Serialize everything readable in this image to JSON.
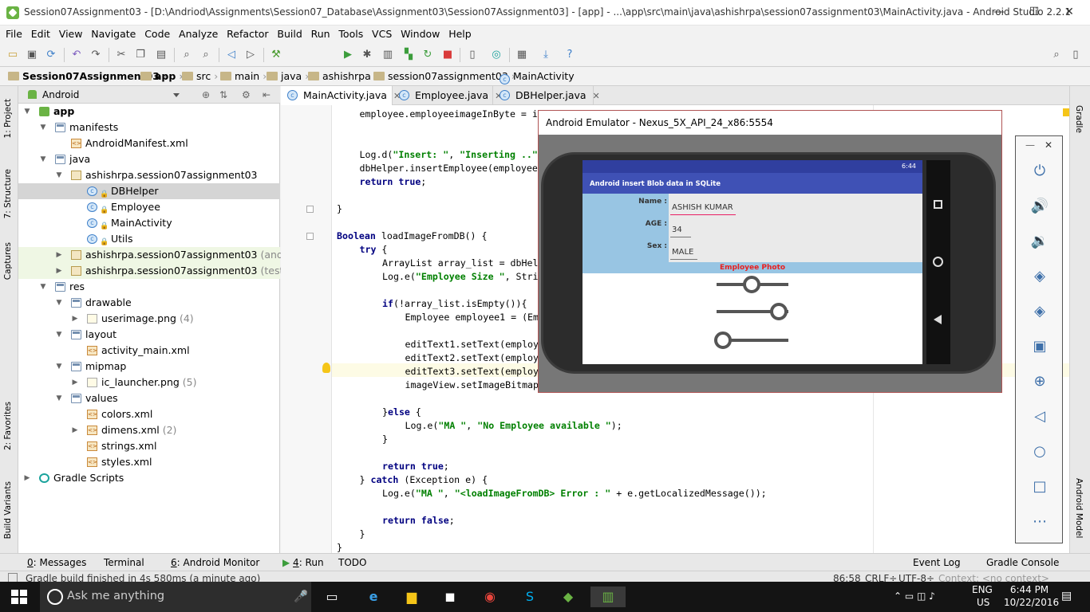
{
  "window": {
    "title": "Session07Assignment03 - [D:\\Andriod\\Assignments\\Session07_Database\\Assignment03\\Session07Assignment03] - [app] - ...\\app\\src\\main\\java\\ashishrpa\\session07assignment03\\MainActivity.java - Android Studio 2.2.1"
  },
  "menu": [
    "File",
    "Edit",
    "View",
    "Navigate",
    "Code",
    "Analyze",
    "Refactor",
    "Build",
    "Run",
    "Tools",
    "VCS",
    "Window",
    "Help"
  ],
  "toolbar": {
    "run_config": "app"
  },
  "breadcrumb": [
    "Session07Assignment03",
    "app",
    "src",
    "main",
    "java",
    "ashishrpa",
    "session07assignment03",
    "MainActivity"
  ],
  "left_tabs": [
    "1: Project",
    "7: Structure",
    "Captures",
    "2: Favorites",
    "Build Variants"
  ],
  "right_tabs": [
    "Gradle",
    "Android Model"
  ],
  "project": {
    "view_selector": "Android",
    "tree": [
      {
        "label": "app",
        "icon": "app-folder-icon",
        "depth": 0,
        "arrow": "▼",
        "bold": true
      },
      {
        "label": "manifests",
        "icon": "folder-icon",
        "depth": 1,
        "arrow": "▼"
      },
      {
        "label": "AndroidManifest.xml",
        "icon": "xml-file-icon",
        "depth": 2,
        "arrow": ""
      },
      {
        "label": "java",
        "icon": "folder-icon",
        "depth": 1,
        "arrow": "▼"
      },
      {
        "label": "ashishrpa.session07assignment03",
        "icon": "package-icon",
        "depth": 2,
        "arrow": "▼"
      },
      {
        "label": "DBHelper",
        "icon": "class-icon",
        "depth": 3,
        "arrow": "",
        "selected": true
      },
      {
        "label": "Employee",
        "icon": "class-icon",
        "depth": 3,
        "arrow": ""
      },
      {
        "label": "MainActivity",
        "icon": "class-icon",
        "depth": 3,
        "arrow": ""
      },
      {
        "label": "Utils",
        "icon": "class-icon",
        "depth": 3,
        "arrow": ""
      },
      {
        "label": "ashishrpa.session07assignment03",
        "suffix": "(androidTest)",
        "icon": "package-icon",
        "depth": 2,
        "arrow": "▶",
        "test": true
      },
      {
        "label": "ashishrpa.session07assignment03",
        "suffix": "(test)",
        "icon": "package-icon",
        "depth": 2,
        "arrow": "▶",
        "test": true
      },
      {
        "label": "res",
        "icon": "folder-icon",
        "depth": 1,
        "arrow": "▼"
      },
      {
        "label": "drawable",
        "icon": "folder-icon",
        "depth": 2,
        "arrow": "▼"
      },
      {
        "label": "userimage.png",
        "suffix": "(4)",
        "icon": "image-folder-icon",
        "depth": 3,
        "arrow": "▶"
      },
      {
        "label": "layout",
        "icon": "folder-icon",
        "depth": 2,
        "arrow": "▼"
      },
      {
        "label": "activity_main.xml",
        "icon": "xml-file-icon",
        "depth": 3,
        "arrow": ""
      },
      {
        "label": "mipmap",
        "icon": "folder-icon",
        "depth": 2,
        "arrow": "▼"
      },
      {
        "label": "ic_launcher.png",
        "suffix": "(5)",
        "icon": "image-folder-icon",
        "depth": 3,
        "arrow": "▶"
      },
      {
        "label": "values",
        "icon": "folder-icon",
        "depth": 2,
        "arrow": "▼"
      },
      {
        "label": "colors.xml",
        "icon": "xml-file-icon",
        "depth": 3,
        "arrow": ""
      },
      {
        "label": "dimens.xml",
        "suffix": "(2)",
        "icon": "xml-file-icon",
        "depth": 3,
        "arrow": "▶"
      },
      {
        "label": "strings.xml",
        "icon": "xml-file-icon",
        "depth": 3,
        "arrow": ""
      },
      {
        "label": "styles.xml",
        "icon": "xml-file-icon",
        "depth": 3,
        "arrow": ""
      },
      {
        "label": "Gradle Scripts",
        "icon": "gradle-icon",
        "depth": 0,
        "arrow": "▶"
      }
    ]
  },
  "editor_tabs": [
    {
      "label": "MainActivity.java",
      "active": true
    },
    {
      "label": "Employee.java",
      "active": false
    },
    {
      "label": "DBHelper.java",
      "active": false
    }
  ],
  "code": [
    {
      "indent": 2,
      "text": "employee.employeeimageInByte = i"
    },
    {
      "indent": 0,
      "text": ""
    },
    {
      "indent": 0,
      "text": ""
    },
    {
      "indent": 2,
      "text": "Log.d(\"Insert: \", \"Inserting ..\""
    },
    {
      "indent": 2,
      "text": "dbHelper.insertEmployee(employee"
    },
    {
      "indent": 2,
      "text": "return true;"
    },
    {
      "indent": 0,
      "text": ""
    },
    {
      "indent": 1,
      "text": "}"
    },
    {
      "indent": 0,
      "text": ""
    },
    {
      "indent": 1,
      "text": "Boolean loadImageFromDB() {"
    },
    {
      "indent": 2,
      "text": "try {"
    },
    {
      "indent": 3,
      "text": "ArrayList array_list = dbHel"
    },
    {
      "indent": 3,
      "text": "Log.e(\"Employee Size \", Stri"
    },
    {
      "indent": 0,
      "text": ""
    },
    {
      "indent": 3,
      "text": "if(!array_list.isEmpty()){"
    },
    {
      "indent": 4,
      "text": "Employee employee1 = (Em"
    },
    {
      "indent": 0,
      "text": ""
    },
    {
      "indent": 4,
      "text": "editText1.setText(employ"
    },
    {
      "indent": 4,
      "text": "editText2.setText(employ"
    },
    {
      "indent": 4,
      "text": "editText3.setText(employ"
    },
    {
      "indent": 4,
      "text": "imageView.setImageBitmap"
    },
    {
      "indent": 0,
      "text": ""
    },
    {
      "indent": 3,
      "text": "}else {"
    },
    {
      "indent": 4,
      "text": "Log.e(\"MA \", \"No Employee available \");"
    },
    {
      "indent": 3,
      "text": "}"
    },
    {
      "indent": 0,
      "text": ""
    },
    {
      "indent": 3,
      "text": "return true;"
    },
    {
      "indent": 2,
      "text": "} catch (Exception e) {"
    },
    {
      "indent": 3,
      "text": "Log.e(\"MA \", \"<loadImageFromDB> Error : \" + e.getLocalizedMessage());"
    },
    {
      "indent": 0,
      "text": ""
    },
    {
      "indent": 3,
      "text": "return false;"
    },
    {
      "indent": 2,
      "text": "}"
    },
    {
      "indent": 1,
      "text": "}"
    }
  ],
  "emulator": {
    "title": "Android Emulator - Nexus_5X_API_24_x86:5554",
    "status_time": "6:44",
    "app_title": "Android insert Blob data in SQLite",
    "form": [
      {
        "label": "Name :",
        "value": "ASHISH KUMAR"
      },
      {
        "label": "AGE :",
        "value": "34"
      },
      {
        "label": "Sex :",
        "value": "MALE"
      }
    ],
    "photo_label": "Employee Photo",
    "controls": [
      "power-icon",
      "volume-up-icon",
      "volume-down-icon",
      "rotate-left-icon",
      "rotate-right-icon",
      "camera-icon",
      "zoom-icon",
      "back-icon",
      "home-icon",
      "overview-icon",
      "more-icon"
    ]
  },
  "bottom_tabs": [
    {
      "key": "0",
      "label": ": Messages"
    },
    {
      "key": "",
      "label": "Terminal"
    },
    {
      "key": "6",
      "label": ": Android Monitor"
    },
    {
      "key": "4",
      "label": ": Run"
    },
    {
      "key": "",
      "label": "TODO"
    },
    {
      "key": "",
      "label": "Event Log"
    },
    {
      "key": "",
      "label": "Gradle Console"
    }
  ],
  "status": {
    "message": "Gradle build finished in 4s 580ms (a minute ago)",
    "position": "86:58",
    "line_sep": "CRLF÷",
    "encoding": "UTF-8÷",
    "context": "Context: <no context>"
  },
  "taskbar": {
    "search_placeholder": "Ask me anything",
    "lang": "ENG",
    "region": "US",
    "time": "6:44 PM",
    "date": "10/22/2016"
  },
  "colors": {
    "accent": "#3f51b5",
    "status_bar": "#303f9f",
    "form_bg": "#98c5e3",
    "photo_label": "#e91e1e",
    "selection": "#d5d5d5",
    "keyword": "#000080",
    "string": "#008000"
  }
}
